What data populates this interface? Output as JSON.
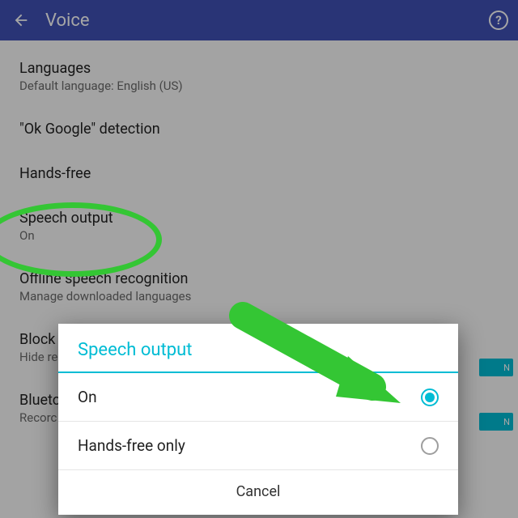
{
  "header": {
    "title": "Voice"
  },
  "settings": {
    "languages": {
      "title": "Languages",
      "sub": "Default language: English (US)"
    },
    "okgoogle": {
      "title": "\"Ok Google\" detection"
    },
    "handsfree": {
      "title": "Hands-free"
    },
    "speech": {
      "title": "Speech output",
      "sub": "On"
    },
    "offline": {
      "title": "Offline speech recognition",
      "sub": "Manage downloaded languages"
    },
    "block": {
      "title": "Block",
      "sub": "Hide re",
      "toggle": "N"
    },
    "blueto": {
      "title": "Blueto",
      "sub": "Recorc",
      "toggle": "N"
    }
  },
  "dialog": {
    "title": "Speech output",
    "options": [
      {
        "label": "On",
        "checked": true
      },
      {
        "label": "Hands-free only",
        "checked": false
      }
    ],
    "cancel": "Cancel"
  }
}
